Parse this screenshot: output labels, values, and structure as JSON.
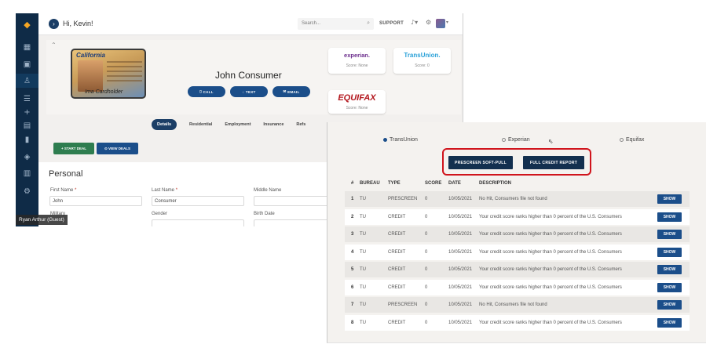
{
  "topbar": {
    "greeting": "Hi, Kevin!",
    "search_placeholder": "Search...",
    "support_label": "SUPPORT",
    "toggle_glyph": "›"
  },
  "sidebar": {
    "icons": [
      "logo-icon",
      "dashboard-icon",
      "briefcase-icon",
      "user-icon",
      "list-icon",
      "plus-icon",
      "grid-icon",
      "chart-icon",
      "tag-icon",
      "org-icon",
      "settings-icon"
    ],
    "guest_label": "Ryan Arthur (Guest)"
  },
  "profile": {
    "name": "John Consumer",
    "id_state": "California",
    "id_signature": "Ima Cardholder",
    "actions": [
      "CALL",
      "TEXT",
      "EMAIL"
    ],
    "bureaus": [
      {
        "name": "experian.",
        "score": "Score: None"
      },
      {
        "name": "TransUnion.",
        "score": "Score: 0"
      },
      {
        "name": "EQUIFAX",
        "score": "Score: None"
      }
    ]
  },
  "tabs": [
    "Details",
    "Residential",
    "Employment",
    "Insurance",
    "Refs"
  ],
  "buttons": {
    "start_deal": "+ START DEAL",
    "view_deals": "⊙ VIEW DEALS"
  },
  "personal": {
    "title": "Personal",
    "first_name_label": "First Name",
    "first_name_value": "John",
    "last_name_label": "Last Name",
    "last_name_value": "Consumer",
    "middle_name_label": "Middle Name",
    "military_label": "Military",
    "gender_label": "Gender",
    "birth_date_label": "Birth Date",
    "required_mark": "*"
  },
  "credit_panel": {
    "bureau_options": [
      {
        "label": "TransUnion",
        "selected": true
      },
      {
        "label": "Experian",
        "selected": false
      },
      {
        "label": "Equifax",
        "selected": false
      }
    ],
    "prescreen_button": "PRESCREEN SOFT-PULL",
    "full_report_button": "FULL CREDIT REPORT",
    "columns": [
      "#",
      "BUREAU",
      "TYPE",
      "SCORE",
      "DATE",
      "DESCRIPTION"
    ],
    "show_label": "SHOW",
    "rows": [
      {
        "num": "1",
        "bureau": "TU",
        "type": "PRESCREEN",
        "score": "0",
        "date": "10/05/2021",
        "desc": "No Hit, Consumers file not found"
      },
      {
        "num": "2",
        "bureau": "TU",
        "type": "CREDIT",
        "score": "0",
        "date": "10/05/2021",
        "desc": "Your credit score ranks higher than 0 percent of the U.S. Consumers"
      },
      {
        "num": "3",
        "bureau": "TU",
        "type": "CREDIT",
        "score": "0",
        "date": "10/05/2021",
        "desc": "Your credit score ranks higher than 0 percent of the U.S. Consumers"
      },
      {
        "num": "4",
        "bureau": "TU",
        "type": "CREDIT",
        "score": "0",
        "date": "10/05/2021",
        "desc": "Your credit score ranks higher than 0 percent of the U.S. Consumers"
      },
      {
        "num": "5",
        "bureau": "TU",
        "type": "CREDIT",
        "score": "0",
        "date": "10/05/2021",
        "desc": "Your credit score ranks higher than 0 percent of the U.S. Consumers"
      },
      {
        "num": "6",
        "bureau": "TU",
        "type": "CREDIT",
        "score": "0",
        "date": "10/05/2021",
        "desc": "Your credit score ranks higher than 0 percent of the U.S. Consumers"
      },
      {
        "num": "7",
        "bureau": "TU",
        "type": "PRESCREEN",
        "score": "0",
        "date": "10/05/2021",
        "desc": "No Hit, Consumers file not found"
      },
      {
        "num": "8",
        "bureau": "TU",
        "type": "CREDIT",
        "score": "0",
        "date": "10/05/2021",
        "desc": "Your credit score ranks higher than 0 percent of the U.S. Consumers"
      }
    ]
  },
  "colors": {
    "sidebar": "#0f2b47",
    "primary_button": "#1b4e8a",
    "dark_button": "#13304f",
    "start_deal": "#2e7d4f",
    "highlight_border": "#d0141c",
    "experian_purple": "#6b2d8c",
    "transunion_blue": "#2aa1d8",
    "equifax_red": "#b3171e"
  }
}
